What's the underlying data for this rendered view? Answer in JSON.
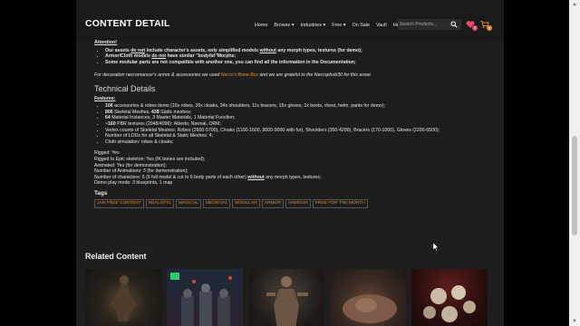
{
  "header": {
    "logo": "CONTENT DETAIL",
    "nav": [
      "Home",
      "Browse",
      "Industries",
      "Free",
      "On Sale",
      "Vault",
      "Help"
    ],
    "search_placeholder": "Search Products...",
    "wishlist_count": "0",
    "cart_count": "0"
  },
  "attention": {
    "title": "Attention!",
    "items": [
      "Our assets do not include character's assets, only simplified models without any morph types, textures (for demo);",
      "Armor/Cloth models do not have similar \"bodyfat\"Morphs;",
      "Some modular parts are not compatible with another one, you can find all the information in the Documentation;"
    ],
    "decoration_note_pre": "For decoration necromancer's armor & accessories we used ",
    "decoration_link": "Necro's Bone Box",
    "decoration_note_post": " and we are grateful to the Necrophob30 for this asset."
  },
  "technical": {
    "heading": "Technical Details",
    "features_title": "Features:",
    "features": [
      {
        "bold": "106",
        "text": " accessories & robes items (16x robes, 26x cloaks, 34x shoulders, 11x bracers, 15x gloves, 1x boots, chest, helm, pants for demo);"
      },
      {
        "bold": "806",
        "text": " Skeletal Meshes, ",
        "bold2": "438",
        "text2": " Static meshes;"
      },
      {
        "bold": "64",
        "text": " Material Instances, 3 Master Materials, 1 Material Function;"
      },
      {
        "bold": "~160",
        "text": " PBR textures (2048/4096): Albedo, Normal, ORM;"
      },
      {
        "bold": "",
        "text": "Vertex counts of Skeletal Meshes: Robes (2600-5700), Cloaks (1100-1600, 8000-9000 with fur), Shoulders (350-4200), Bracers (170-1000), Gloves (2200-6500);"
      },
      {
        "bold": "",
        "text": "Number of LODs for all Skeletal & Static Meshes: 4;"
      },
      {
        "bold": "",
        "text": "Cloth simulation: robes & cloaks;"
      }
    ],
    "specs": [
      "Rigged: Yes",
      "Rigged to Epic skeleton: Yes (IK bones are included);",
      "Animated: Yes (for demonstration);",
      "Number of Animations: 3 (for demonstration);"
    ],
    "characters_pre": "Number of characters: 6 (6 full model & cut to 6 body parts of each other) ",
    "characters_underline": "without",
    "characters_post": " any morph types, textures;",
    "demo_map": "Demo play mode: 3 blueprints, 1 map"
  },
  "tags": {
    "title": "Tags",
    "items": [
      "JAN FREE CONTENT",
      "REALISTIC",
      "MAGICAL",
      "MEDIEVAL",
      "MODULAR",
      "ARMOR",
      "ARMOUR",
      "FREE FOR THE MONTH"
    ]
  },
  "related": {
    "title": "Related Content"
  }
}
